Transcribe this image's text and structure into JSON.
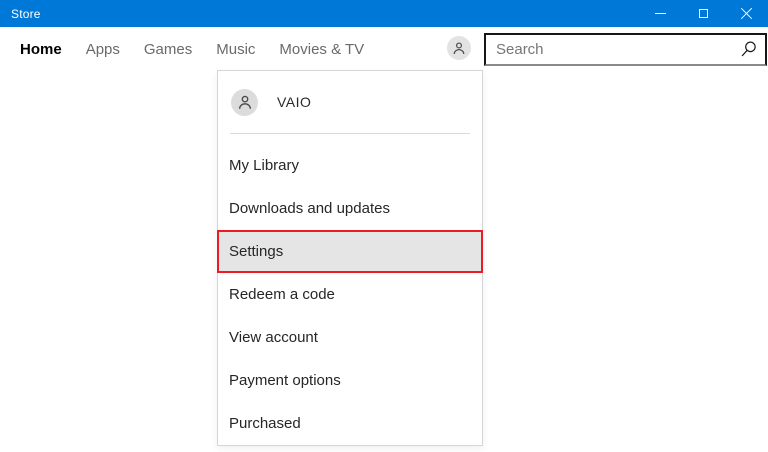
{
  "window": {
    "title": "Store"
  },
  "titlebar": {
    "color": "#0078d7",
    "controls": {
      "minimize_icon": "minimize-icon",
      "maximize_icon": "maximize-icon",
      "close_icon": "close-icon"
    }
  },
  "nav": {
    "items": [
      {
        "label": "Home",
        "active": true
      },
      {
        "label": "Apps",
        "active": false
      },
      {
        "label": "Games",
        "active": false
      },
      {
        "label": "Music",
        "active": false
      },
      {
        "label": "Movies & TV",
        "active": false
      }
    ],
    "account_button_icon": "person-icon",
    "search": {
      "placeholder": "Search",
      "value": "",
      "icon": "magnifier-icon"
    }
  },
  "account_menu": {
    "user": "VAIO",
    "user_avatar_icon": "person-icon",
    "items": [
      {
        "label": "My Library",
        "highlighted": false
      },
      {
        "label": "Downloads and updates",
        "highlighted": false
      },
      {
        "label": "Settings",
        "highlighted": true
      },
      {
        "label": "Redeem a code",
        "highlighted": false
      },
      {
        "label": "View account",
        "highlighted": false
      },
      {
        "label": "Payment options",
        "highlighted": false
      },
      {
        "label": "Purchased",
        "highlighted": false
      }
    ],
    "highlight": {
      "border_color": "#ed1c24",
      "background_color": "#e5e5e5"
    }
  }
}
